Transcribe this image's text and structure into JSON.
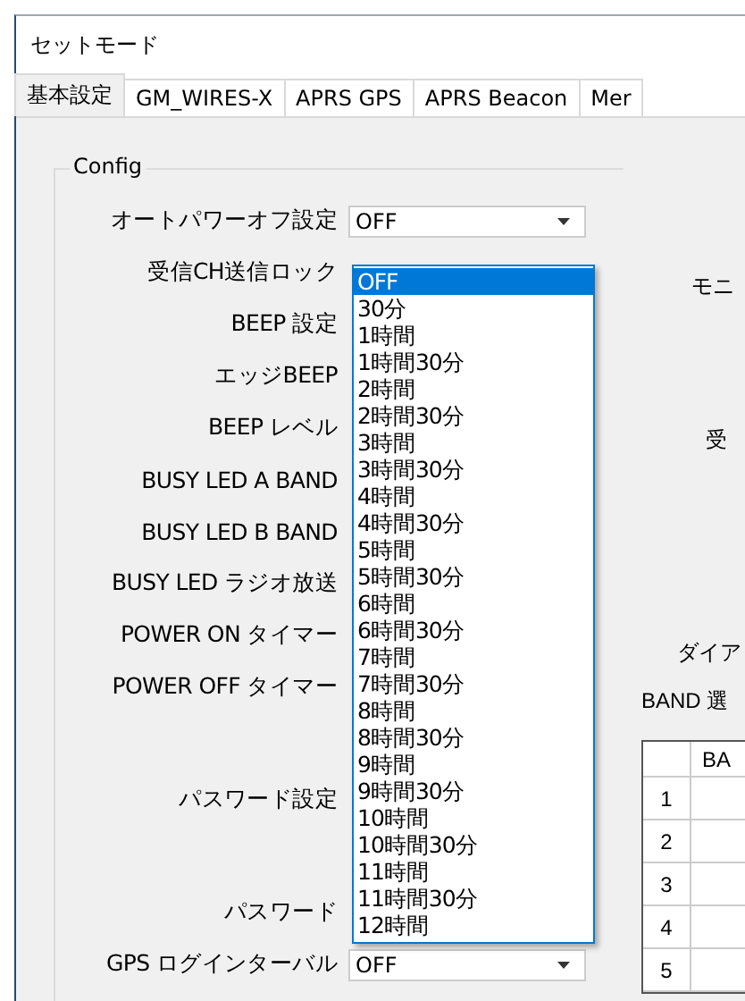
{
  "window": {
    "title": "セットモード"
  },
  "tabs": [
    {
      "label": "基本設定",
      "selected": true
    },
    {
      "label": "GM_WIRES-X",
      "selected": false
    },
    {
      "label": "APRS GPS",
      "selected": false
    },
    {
      "label": "APRS Beacon",
      "selected": false
    },
    {
      "label": "Mer",
      "selected": false
    }
  ],
  "config": {
    "title": "Config",
    "settings": [
      {
        "label": "オートパワーオフ設定",
        "value": "OFF"
      },
      {
        "label": "受信CH送信ロック"
      },
      {
        "label": "BEEP 設定"
      },
      {
        "label": "エッジBEEP"
      },
      {
        "label": "BEEP レベル"
      },
      {
        "label": "BUSY LED A BAND"
      },
      {
        "label": "BUSY LED B BAND"
      },
      {
        "label": "BUSY LED ラジオ放送"
      },
      {
        "label": "POWER ON タイマー"
      },
      {
        "label": "POWER OFF タイマー"
      },
      {
        "label": "パスワード設定"
      },
      {
        "label": "パスワード"
      },
      {
        "label": "GPS ログインターバル",
        "value": "OFF"
      }
    ]
  },
  "dropdown": {
    "options": [
      {
        "label": "OFF",
        "selected": true
      },
      {
        "label": "30分",
        "selected": false
      },
      {
        "label": "1時間",
        "selected": false
      },
      {
        "label": "1時間30分",
        "selected": false
      },
      {
        "label": "2時間",
        "selected": false
      },
      {
        "label": "2時間30分",
        "selected": false
      },
      {
        "label": "3時間",
        "selected": false
      },
      {
        "label": "3時間30分",
        "selected": false
      },
      {
        "label": "4時間",
        "selected": false
      },
      {
        "label": "4時間30分",
        "selected": false
      },
      {
        "label": "5時間",
        "selected": false
      },
      {
        "label": "5時間30分",
        "selected": false
      },
      {
        "label": "6時間",
        "selected": false
      },
      {
        "label": "6時間30分",
        "selected": false
      },
      {
        "label": "7時間",
        "selected": false
      },
      {
        "label": "7時間30分",
        "selected": false
      },
      {
        "label": "8時間",
        "selected": false
      },
      {
        "label": "8時間30分",
        "selected": false
      },
      {
        "label": "9時間",
        "selected": false
      },
      {
        "label": "9時間30分",
        "selected": false
      },
      {
        "label": "10時間",
        "selected": false
      },
      {
        "label": "10時間30分",
        "selected": false
      },
      {
        "label": "11時間",
        "selected": false
      },
      {
        "label": "11時間30分",
        "selected": false
      },
      {
        "label": "12時間",
        "selected": false
      }
    ]
  },
  "right_panel": {
    "labels": [
      "モニ",
      "受",
      "ダイア",
      "BAND 選"
    ],
    "table": {
      "columns": [
        "",
        "BA"
      ],
      "rows": [
        "1",
        "2",
        "3",
        "4",
        "5"
      ]
    }
  }
}
